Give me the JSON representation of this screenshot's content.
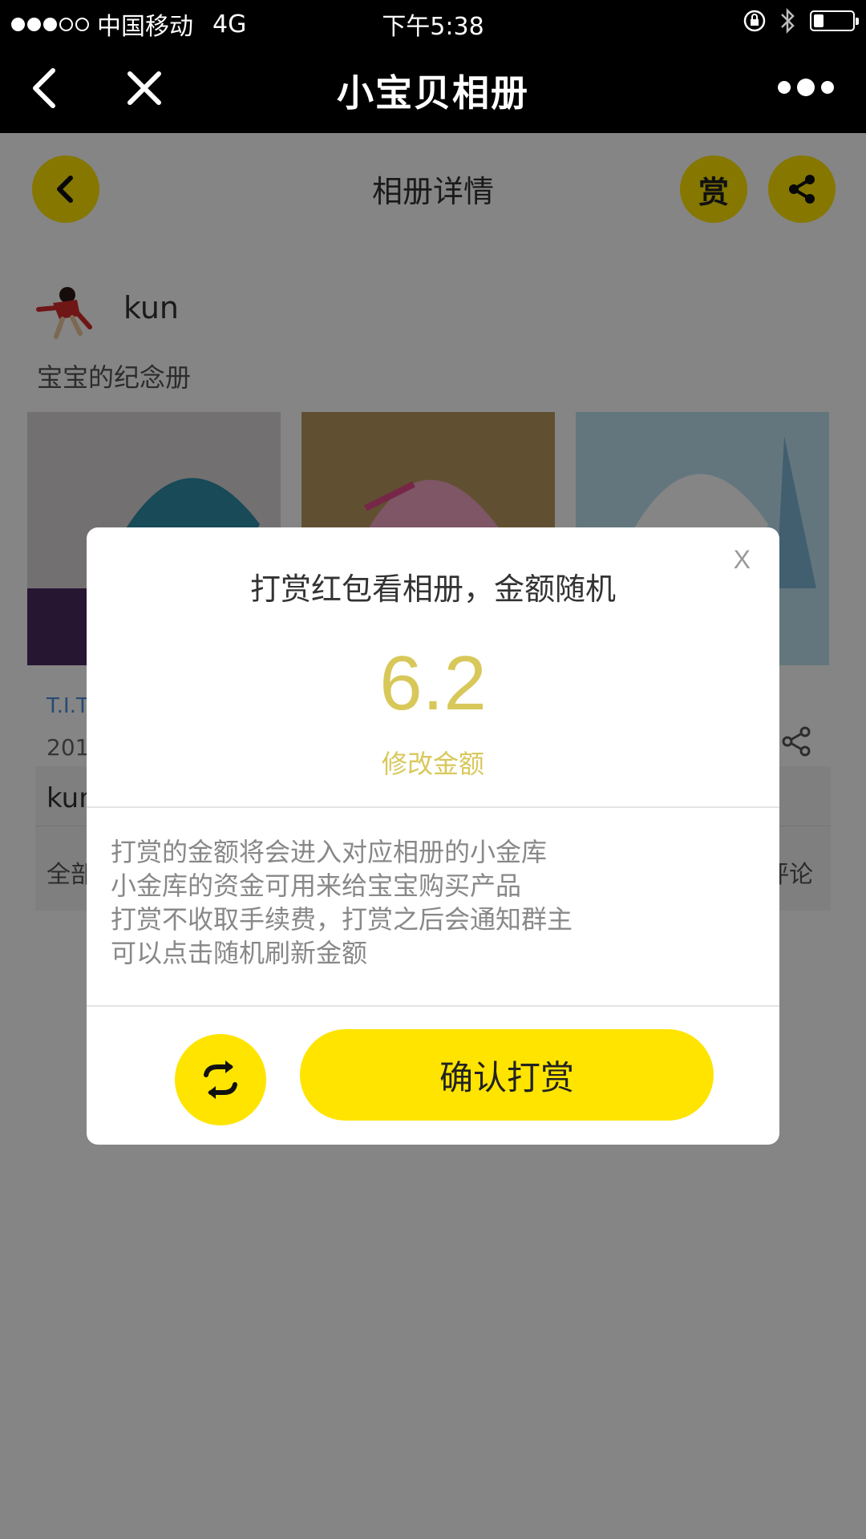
{
  "status_bar": {
    "signal_dots_filled": 3,
    "signal_dots_total": 5,
    "carrier": "中国移动",
    "network": "4G",
    "time": "下午5:38"
  },
  "nav": {
    "title": "小宝贝相册",
    "back_icon": "chevron-left-icon",
    "close_icon": "close-icon",
    "more_icon": "more-dots-icon"
  },
  "page": {
    "title": "相册详情",
    "reward_char": "赏",
    "username": "kun",
    "album_description": "宝宝的纪念册",
    "post_link": "T.I.T",
    "post_date": "201",
    "post_author": "kun",
    "tab_all": "全部",
    "tab_comment": "评论"
  },
  "modal": {
    "close_label": "X",
    "heading": "打赏红包看相册，金额随机",
    "amount": "6.2",
    "edit_label": "修改金额",
    "notes": [
      "打赏的金额将会进入对应相册的小金库",
      "小金库的资金可用来给宝宝购买产品",
      "打赏不收取手续费，打赏之后会通知群主",
      "可以点击随机刷新金额"
    ],
    "confirm_label": "确认打赏",
    "refresh_icon": "refresh-icon"
  },
  "colors": {
    "accent_yellow": "#ffe400",
    "amount_gold": "#d8c85a",
    "link_blue": "#4a8fd8"
  }
}
